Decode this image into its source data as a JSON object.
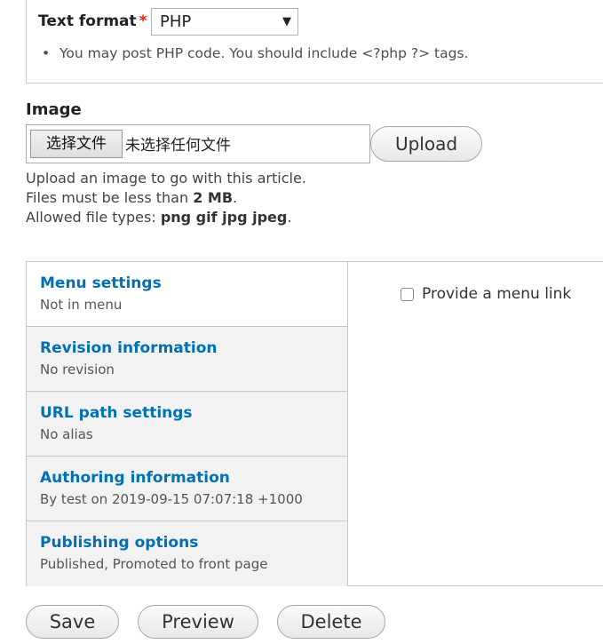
{
  "text_format": {
    "label": "Text format",
    "required_mark": "*",
    "selected": "PHP",
    "tip": "You may post PHP code. You should include <?php ?> tags."
  },
  "image": {
    "label": "Image",
    "choose_button": "选择文件",
    "no_file_text": "未选择任何文件",
    "upload_button": "Upload",
    "desc_line1": "Upload an image to go with this article.",
    "desc_line2_prefix": "Files must be less than ",
    "desc_line2_value": "2 MB",
    "desc_line3_prefix": "Allowed file types: ",
    "desc_line3_value": "png gif jpg jpeg",
    "period": "."
  },
  "vertical_tabs": [
    {
      "title": "Menu settings",
      "summary": "Not in menu",
      "active": true
    },
    {
      "title": "Revision information",
      "summary": "No revision"
    },
    {
      "title": "URL path settings",
      "summary": "No alias"
    },
    {
      "title": "Authoring information",
      "summary": "By test on 2019-09-15 07:07:18 +1000"
    },
    {
      "title": "Publishing options",
      "summary": "Published, Promoted to front page"
    }
  ],
  "menu_pane": {
    "checkbox_label": "Provide a menu link",
    "checked": false
  },
  "actions": {
    "save": "Save",
    "preview": "Preview",
    "delete": "Delete"
  }
}
